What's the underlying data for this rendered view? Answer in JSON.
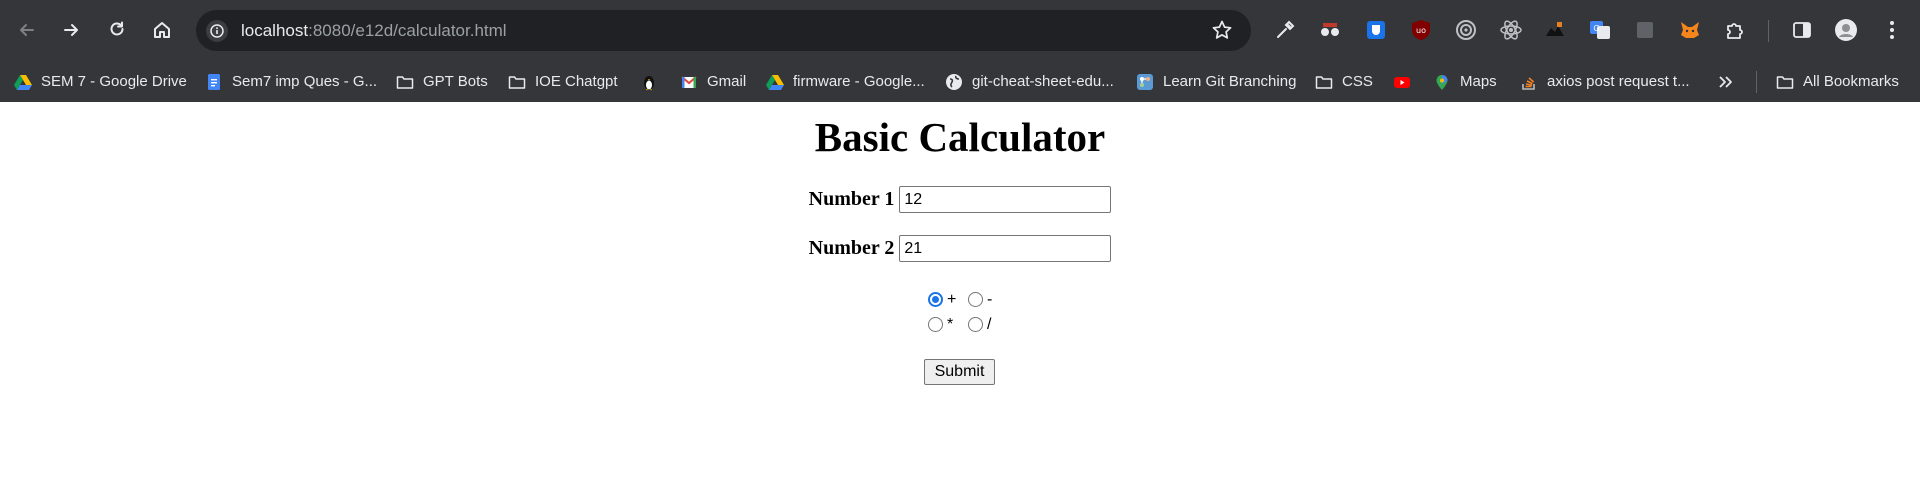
{
  "browser": {
    "url_host": "localhost",
    "url_rest": ":8080/e12d/calculator.html",
    "bookmarks": [
      {
        "label": "SEM 7 - Google Drive",
        "icon": "google-drive-icon"
      },
      {
        "label": "Sem7 imp Ques - G...",
        "icon": "google-docs-icon"
      },
      {
        "label": "GPT Bots",
        "icon": "folder-icon"
      },
      {
        "label": "IOE Chatgpt",
        "icon": "folder-icon"
      },
      {
        "label": "",
        "icon": "linux-penguin-icon"
      },
      {
        "label": "Gmail",
        "icon": "gmail-icon"
      },
      {
        "label": "firmware - Google...",
        "icon": "google-drive-icon"
      },
      {
        "label": "git-cheat-sheet-edu...",
        "icon": "globe-icon"
      },
      {
        "label": "Learn Git Branching",
        "icon": "git-branching-icon"
      },
      {
        "label": "CSS",
        "icon": "folder-icon"
      },
      {
        "label": "",
        "icon": "youtube-icon"
      },
      {
        "label": "Maps",
        "icon": "google-maps-icon"
      },
      {
        "label": "axios post request t...",
        "icon": "stackoverflow-icon"
      },
      {
        "label": "All Bookmarks",
        "icon": "folder-icon"
      }
    ]
  },
  "page": {
    "title": "Basic Calculator",
    "number1": {
      "label": "Number 1",
      "value": "12"
    },
    "number2": {
      "label": "Number 2",
      "value": "21"
    },
    "operations": [
      {
        "label": "+",
        "checked": true
      },
      {
        "label": "-",
        "checked": false
      },
      {
        "label": "*",
        "checked": false
      },
      {
        "label": "/",
        "checked": false
      }
    ],
    "submit_label": "Submit"
  }
}
